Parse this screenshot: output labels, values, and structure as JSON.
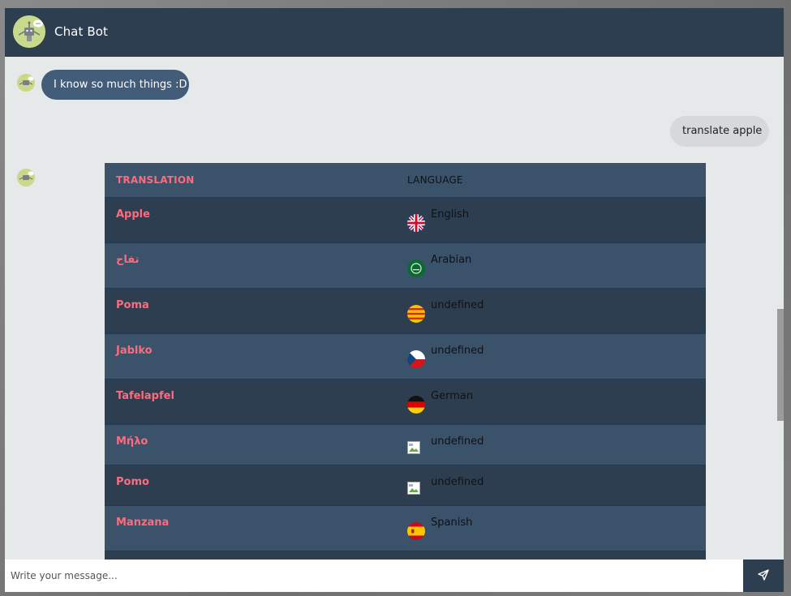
{
  "header": {
    "title": "Chat Bot",
    "avatar_icon": "robot-avatar-icon"
  },
  "messages": {
    "bot_greeting": "I know so much things :D",
    "user_query": "translate apple"
  },
  "translation_table": {
    "headers": {
      "translation": "TRANSLATION",
      "language": "LANGUAGE"
    },
    "rows": [
      {
        "word": "Apple",
        "language": "English",
        "flag": "uk-flag-icon"
      },
      {
        "word": "تفاح",
        "language": "Arabian",
        "flag": "saudi-flag-icon"
      },
      {
        "word": "Poma",
        "language": "undefined",
        "flag": "catalan-flag-icon"
      },
      {
        "word": "Jablko",
        "language": "undefined",
        "flag": "czech-flag-icon"
      },
      {
        "word": "Tafelapfel",
        "language": "German",
        "flag": "german-flag-icon"
      },
      {
        "word": "Μήλο",
        "language": "undefined",
        "flag": "broken-image-icon"
      },
      {
        "word": "Pomo",
        "language": "undefined",
        "flag": "broken-image-icon"
      },
      {
        "word": "Manzana",
        "language": "Spanish",
        "flag": "spanish-flag-icon"
      }
    ]
  },
  "composer": {
    "placeholder": "Write your message...",
    "send_icon": "send-icon"
  },
  "colors": {
    "header_bg": "#2e3e51",
    "bot_bubble_bg": "#435d79",
    "user_bubble_bg": "#d5d9da",
    "chat_bg": "#e5e9ea",
    "table_dark": "#2e3e51",
    "table_light": "#3b526b",
    "accent_pink": "#ff6b7d"
  }
}
